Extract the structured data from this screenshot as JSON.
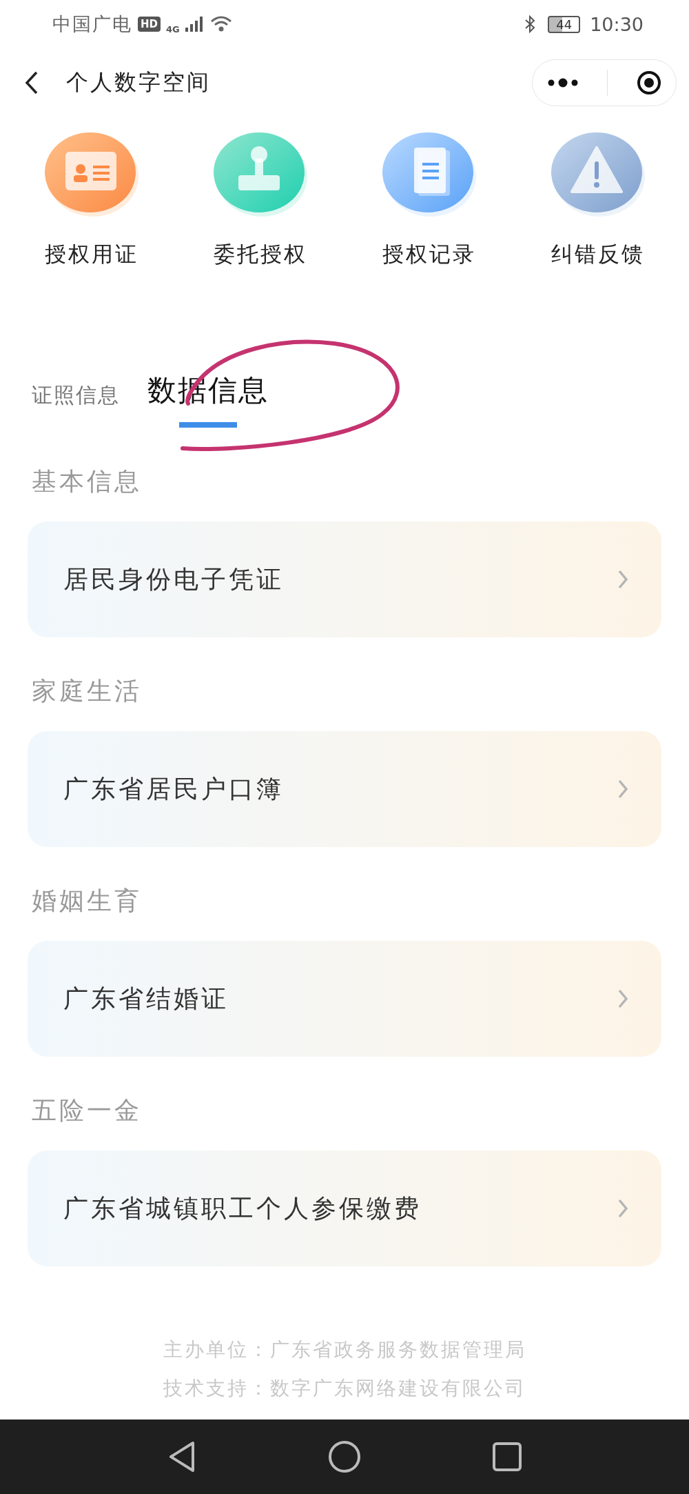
{
  "status_bar": {
    "carrier": "中国广电",
    "hd": "HD",
    "network": "4G",
    "battery": "44",
    "time": "10:30"
  },
  "nav": {
    "title": "个人数字空间"
  },
  "actions": [
    {
      "kind": "card",
      "label": "授权用证"
    },
    {
      "kind": "stamp",
      "label": "委托授权"
    },
    {
      "kind": "notebook",
      "label": "授权记录"
    },
    {
      "kind": "warning",
      "label": "纠错反馈"
    }
  ],
  "tabs": [
    {
      "label": "证照信息",
      "selected": false
    },
    {
      "label": "数据信息",
      "selected": true
    }
  ],
  "sections": [
    {
      "title": "基本信息",
      "items": [
        "居民身份电子凭证"
      ]
    },
    {
      "title": "家庭生活",
      "items": [
        "广东省居民户口簿"
      ]
    },
    {
      "title": "婚姻生育",
      "items": [
        "广东省结婚证"
      ]
    },
    {
      "title": "五险一金",
      "items": [
        "广东省城镇职工个人参保缴费"
      ]
    }
  ],
  "footer": [
    "主办单位：广东省政务服务数据管理局",
    "技术支持：数字广东网络建设有限公司"
  ]
}
